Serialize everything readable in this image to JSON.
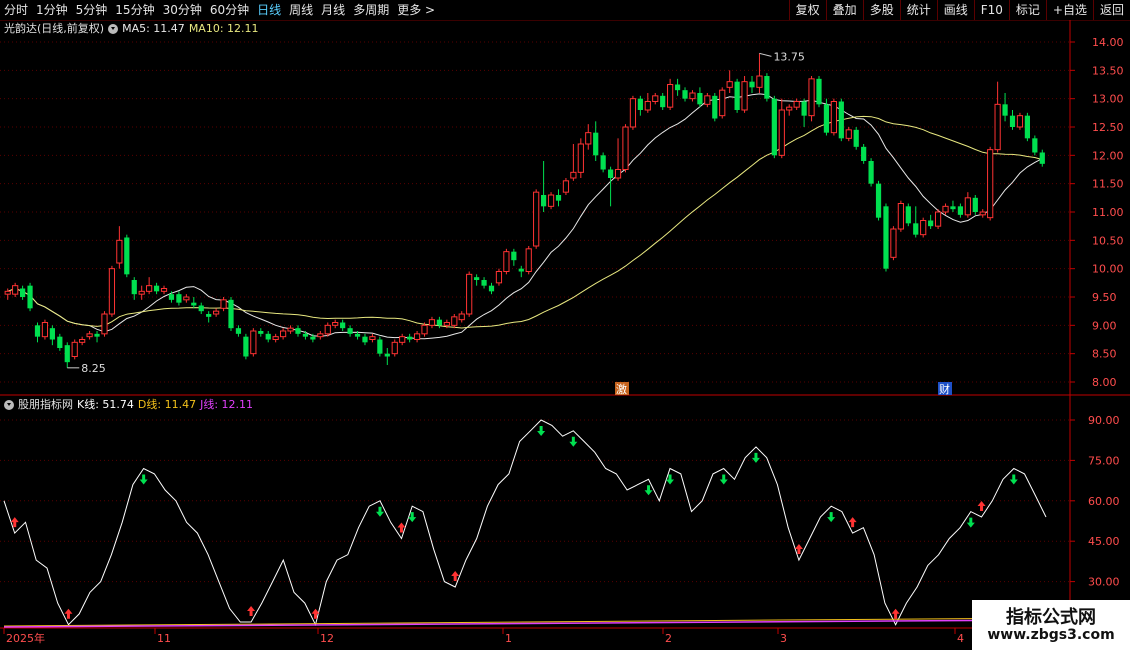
{
  "toolbar": {
    "periods": [
      "分时",
      "1分钟",
      "5分钟",
      "15分钟",
      "30分钟",
      "60分钟",
      "日线",
      "周线",
      "月线",
      "多周期",
      "更多 >"
    ],
    "active_period": "日线",
    "buttons": [
      "复权",
      "叠加",
      "多股",
      "统计",
      "画线",
      "F10",
      "标记",
      "+自选",
      "返回"
    ]
  },
  "main_legend": {
    "stock": "光韵达(日线,前复权)",
    "ma5": "MA5: 11.47",
    "ma10": "MA10: 12.11"
  },
  "indicator_legend": {
    "name": "股朋指标网",
    "k": "K线: 51.74",
    "d": "D线: 11.47",
    "j": "J线: 12.11"
  },
  "colors": {
    "up": "#ff3333",
    "down": "#00e050",
    "ma5": "#e8e8e8",
    "ma10": "#e8e880",
    "k_line": "#ffffff",
    "d_line": "#f2c01b",
    "j_line": "#e040fb",
    "axis": "#c00000",
    "price_label": "#ff4d4d"
  },
  "price_axis": {
    "ticks": [
      "14.00",
      "13.50",
      "13.00",
      "12.50",
      "12.00",
      "11.50",
      "11.00",
      "10.50",
      "10.00",
      "9.50",
      "9.00",
      "8.50",
      "8.00"
    ]
  },
  "indicator_axis": {
    "ticks": [
      "90.00",
      "75.00",
      "60.00",
      "45.00",
      "30.00"
    ]
  },
  "time_axis": {
    "labels": [
      "2025年",
      "11",
      "12",
      "1",
      "2",
      "3",
      "4"
    ]
  },
  "annotations": {
    "high": "13.75",
    "low": "8.25",
    "badge1": "激",
    "badge2": "财"
  },
  "chart_data": {
    "type": "candlestick",
    "ylim": [
      7.85,
      14.15
    ],
    "candles": [
      [
        9.55,
        9.6,
        9.45,
        9.65
      ],
      [
        9.55,
        9.7,
        9.5,
        9.75
      ],
      [
        9.65,
        9.5,
        9.45,
        9.7
      ],
      [
        9.7,
        9.3,
        9.25,
        9.75
      ],
      [
        9.0,
        8.8,
        8.7,
        9.05
      ],
      [
        8.8,
        9.05,
        8.75,
        9.1
      ],
      [
        8.95,
        8.75,
        8.65,
        9.0
      ],
      [
        8.8,
        8.6,
        8.55,
        8.85
      ],
      [
        8.65,
        8.35,
        8.25,
        8.7
      ],
      [
        8.45,
        8.7,
        8.4,
        8.75
      ],
      [
        8.7,
        8.75,
        8.65,
        8.8
      ],
      [
        8.8,
        8.85,
        8.75,
        8.9
      ],
      [
        8.85,
        8.8,
        8.7,
        8.9
      ],
      [
        8.85,
        9.2,
        8.8,
        9.25
      ],
      [
        9.2,
        10.0,
        9.15,
        10.05
      ],
      [
        10.1,
        10.5,
        10.0,
        10.75
      ],
      [
        10.55,
        9.9,
        9.85,
        10.6
      ],
      [
        9.8,
        9.55,
        9.45,
        9.85
      ],
      [
        9.55,
        9.6,
        9.45,
        9.7
      ],
      [
        9.6,
        9.7,
        9.55,
        9.85
      ],
      [
        9.7,
        9.6,
        9.55,
        9.75
      ],
      [
        9.6,
        9.65,
        9.55,
        9.7
      ],
      [
        9.55,
        9.45,
        9.4,
        9.6
      ],
      [
        9.55,
        9.4,
        9.35,
        9.6
      ],
      [
        9.45,
        9.5,
        9.4,
        9.55
      ],
      [
        9.4,
        9.35,
        9.3,
        9.5
      ],
      [
        9.35,
        9.25,
        9.2,
        9.4
      ],
      [
        9.2,
        9.15,
        9.05,
        9.25
      ],
      [
        9.2,
        9.25,
        9.15,
        9.3
      ],
      [
        9.3,
        9.45,
        9.25,
        9.5
      ],
      [
        9.45,
        8.95,
        8.9,
        9.5
      ],
      [
        8.95,
        8.85,
        8.8,
        9.0
      ],
      [
        8.8,
        8.45,
        8.4,
        8.85
      ],
      [
        8.5,
        8.9,
        8.45,
        8.95
      ],
      [
        8.9,
        8.85,
        8.8,
        8.95
      ],
      [
        8.85,
        8.75,
        8.7,
        8.9
      ],
      [
        8.75,
        8.8,
        8.7,
        8.85
      ],
      [
        8.8,
        8.9,
        8.75,
        8.95
      ],
      [
        8.9,
        8.95,
        8.85,
        9.0
      ],
      [
        8.95,
        8.85,
        8.8,
        9.0
      ],
      [
        8.85,
        8.8,
        8.75,
        8.9
      ],
      [
        8.8,
        8.75,
        8.7,
        8.85
      ],
      [
        8.8,
        8.85,
        8.75,
        8.9
      ],
      [
        8.85,
        9.0,
        8.8,
        9.05
      ],
      [
        9.0,
        9.05,
        8.95,
        9.1
      ],
      [
        9.05,
        8.95,
        8.9,
        9.1
      ],
      [
        8.95,
        8.85,
        8.8,
        9.0
      ],
      [
        8.85,
        8.8,
        8.75,
        8.9
      ],
      [
        8.8,
        8.7,
        8.65,
        8.85
      ],
      [
        8.75,
        8.8,
        8.7,
        8.85
      ],
      [
        8.75,
        8.5,
        8.45,
        8.8
      ],
      [
        8.5,
        8.45,
        8.3,
        8.6
      ],
      [
        8.5,
        8.7,
        8.45,
        8.75
      ],
      [
        8.7,
        8.8,
        8.65,
        8.85
      ],
      [
        8.8,
        8.75,
        8.7,
        8.85
      ],
      [
        8.75,
        8.85,
        8.7,
        8.9
      ],
      [
        8.85,
        9.0,
        8.8,
        9.05
      ],
      [
        9.0,
        9.1,
        8.95,
        9.15
      ],
      [
        9.1,
        9.0,
        8.95,
        9.15
      ],
      [
        9.0,
        9.05,
        8.95,
        9.1
      ],
      [
        9.0,
        9.15,
        8.95,
        9.2
      ],
      [
        9.1,
        9.2,
        9.05,
        9.25
      ],
      [
        9.2,
        9.9,
        9.15,
        9.95
      ],
      [
        9.85,
        9.8,
        9.7,
        9.9
      ],
      [
        9.8,
        9.7,
        9.65,
        9.85
      ],
      [
        9.7,
        9.6,
        9.55,
        9.75
      ],
      [
        9.75,
        9.95,
        9.7,
        10.0
      ],
      [
        9.95,
        10.3,
        9.9,
        10.35
      ],
      [
        10.3,
        10.15,
        10.05,
        10.35
      ],
      [
        10.0,
        9.95,
        9.85,
        10.05
      ],
      [
        9.95,
        10.35,
        9.9,
        10.4
      ],
      [
        10.4,
        11.35,
        10.35,
        11.4
      ],
      [
        11.3,
        11.1,
        11.0,
        11.9
      ],
      [
        11.1,
        11.3,
        11.05,
        11.35
      ],
      [
        11.3,
        11.2,
        11.1,
        11.4
      ],
      [
        11.35,
        11.55,
        11.3,
        11.6
      ],
      [
        11.6,
        11.7,
        11.55,
        12.2
      ],
      [
        11.7,
        12.2,
        11.6,
        12.3
      ],
      [
        12.2,
        12.4,
        12.1,
        12.55
      ],
      [
        12.4,
        12.0,
        11.9,
        12.6
      ],
      [
        12.0,
        11.75,
        11.7,
        12.05
      ],
      [
        11.75,
        11.6,
        11.1,
        11.8
      ],
      [
        11.6,
        11.75,
        11.55,
        12.3
      ],
      [
        11.75,
        12.5,
        11.7,
        12.55
      ],
      [
        12.5,
        13.0,
        12.45,
        13.05
      ],
      [
        13.0,
        12.8,
        12.7,
        13.05
      ],
      [
        12.8,
        12.95,
        12.75,
        13.1
      ],
      [
        12.95,
        13.05,
        12.9,
        13.1
      ],
      [
        13.05,
        12.85,
        12.8,
        13.1
      ],
      [
        12.85,
        13.25,
        12.8,
        13.35
      ],
      [
        13.25,
        13.15,
        13.05,
        13.35
      ],
      [
        13.15,
        13.0,
        12.95,
        13.2
      ],
      [
        13.0,
        13.1,
        12.95,
        13.15
      ],
      [
        13.1,
        12.9,
        12.85,
        13.2
      ],
      [
        12.9,
        13.05,
        12.85,
        13.1
      ],
      [
        13.05,
        12.65,
        12.6,
        13.1
      ],
      [
        12.7,
        13.15,
        12.65,
        13.2
      ],
      [
        13.2,
        13.3,
        13.1,
        13.5
      ],
      [
        13.3,
        12.8,
        12.75,
        13.35
      ],
      [
        12.8,
        13.3,
        12.75,
        13.4
      ],
      [
        13.3,
        13.2,
        13.1,
        13.4
      ],
      [
        13.2,
        13.4,
        13.1,
        13.8
      ],
      [
        13.4,
        13.0,
        12.95,
        13.45
      ],
      [
        13.0,
        12.0,
        11.95,
        13.05
      ],
      [
        12.0,
        12.8,
        11.95,
        13.0
      ],
      [
        12.8,
        12.85,
        12.7,
        12.9
      ],
      [
        12.85,
        12.95,
        12.8,
        13.0
      ],
      [
        12.95,
        12.7,
        12.5,
        13.0
      ],
      [
        12.7,
        13.35,
        12.6,
        13.4
      ],
      [
        13.35,
        12.9,
        12.85,
        13.4
      ],
      [
        12.9,
        12.4,
        12.35,
        13.0
      ],
      [
        12.4,
        12.95,
        12.35,
        13.0
      ],
      [
        12.95,
        12.3,
        12.25,
        13.0
      ],
      [
        12.3,
        12.45,
        12.25,
        12.5
      ],
      [
        12.45,
        12.15,
        12.1,
        12.5
      ],
      [
        12.15,
        11.9,
        11.85,
        12.2
      ],
      [
        11.9,
        11.5,
        11.45,
        11.95
      ],
      [
        11.5,
        10.9,
        10.85,
        11.55
      ],
      [
        11.1,
        10.0,
        9.95,
        11.15
      ],
      [
        10.2,
        10.7,
        10.15,
        10.75
      ],
      [
        10.7,
        11.15,
        10.65,
        11.2
      ],
      [
        11.1,
        10.8,
        10.75,
        11.15
      ],
      [
        10.8,
        10.6,
        10.55,
        11.1
      ],
      [
        10.6,
        10.85,
        10.55,
        10.9
      ],
      [
        10.85,
        10.75,
        10.7,
        10.95
      ],
      [
        10.75,
        11.0,
        10.7,
        11.05
      ],
      [
        11.0,
        11.1,
        10.95,
        11.15
      ],
      [
        11.1,
        11.05,
        11.0,
        11.2
      ],
      [
        11.1,
        10.95,
        10.9,
        11.15
      ],
      [
        10.95,
        11.25,
        10.9,
        11.35
      ],
      [
        11.25,
        11.0,
        10.95,
        11.3
      ],
      [
        10.95,
        11.0,
        10.9,
        11.05
      ],
      [
        10.9,
        12.1,
        10.85,
        12.15
      ],
      [
        12.1,
        12.9,
        12.05,
        13.3
      ],
      [
        12.9,
        12.7,
        12.6,
        13.1
      ],
      [
        12.7,
        12.5,
        12.45,
        12.8
      ],
      [
        12.5,
        12.7,
        12.45,
        12.75
      ],
      [
        12.7,
        12.3,
        12.25,
        12.75
      ],
      [
        12.3,
        12.05,
        12.0,
        12.35
      ],
      [
        12.05,
        11.85,
        11.8,
        12.1
      ]
    ],
    "k_values": [
      60,
      48,
      52,
      38,
      35,
      22,
      14,
      18,
      26,
      30,
      40,
      52,
      66,
      72,
      70,
      64,
      60,
      52,
      48,
      40,
      30,
      20,
      15,
      15,
      22,
      30,
      38,
      26,
      22,
      14,
      30,
      38,
      40,
      50,
      58,
      60,
      52,
      46,
      58,
      56,
      42,
      30,
      28,
      38,
      46,
      58,
      66,
      70,
      82,
      86,
      90,
      88,
      84,
      86,
      82,
      78,
      72,
      70,
      64,
      66,
      68,
      60,
      72,
      70,
      56,
      60,
      70,
      72,
      68,
      76,
      80,
      76,
      66,
      50,
      38,
      46,
      54,
      58,
      56,
      48,
      50,
      40,
      22,
      14,
      22,
      28,
      36,
      40,
      46,
      50,
      56,
      54,
      60,
      68,
      72,
      70,
      62,
      54
    ]
  }
}
